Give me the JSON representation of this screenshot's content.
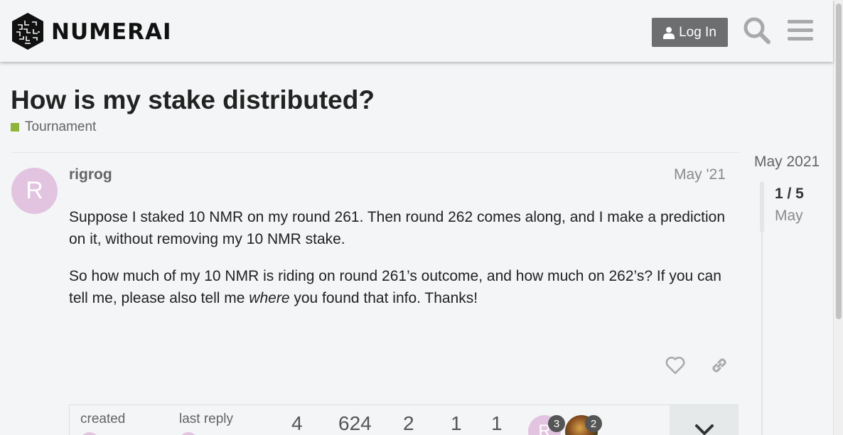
{
  "header": {
    "logo_text": "NUMERAI",
    "login_label": "Log In",
    "search_icon": "search-icon",
    "menu_icon": "hamburger-icon"
  },
  "topic": {
    "title": "How is my stake distributed?",
    "category": "Tournament",
    "category_color": "#8fb33b"
  },
  "post": {
    "avatar_letter": "R",
    "avatar_color": "#e2c4e1",
    "username": "rigrog",
    "date": "May '21",
    "paragraph1": "Suppose I staked 10 NMR on my round 261. Then round 262 comes along, and I make a prediction on it, without removing my 10 NMR stake.",
    "paragraph2_before": "So how much of my 10 NMR is riding on round 261’s outcome, and how much on 262’s? If you can tell me, please also tell me ",
    "paragraph2_em": "where",
    "paragraph2_after": " you found that info. Thanks!"
  },
  "topic_map": {
    "created_label": "created",
    "last_reply_label": "last reply",
    "stats": [
      "4",
      "624",
      "2",
      "1",
      "1"
    ],
    "participants": [
      {
        "letter": "R",
        "count": "3"
      },
      {
        "count": "2"
      }
    ]
  },
  "timeline": {
    "date": "May 2021",
    "position": "1 / 5",
    "month": "May"
  }
}
